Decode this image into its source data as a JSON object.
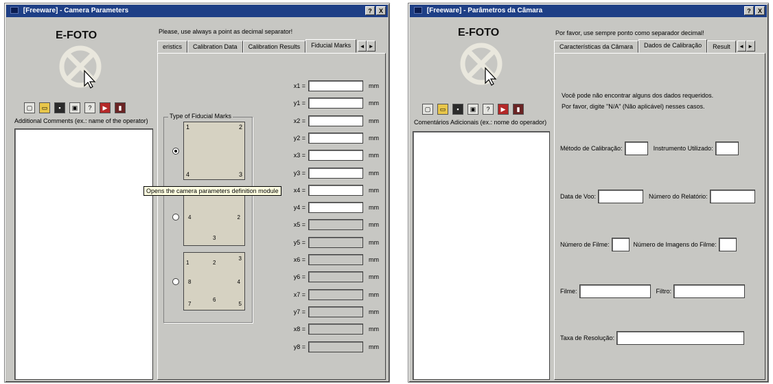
{
  "left": {
    "title": "[Freeware] - Camera Parameters",
    "title_buttons": [
      "?",
      "X"
    ],
    "logo": "E-FOTO",
    "comments_label": "Additional Comments (ex.: name of the operator)",
    "note": "Please, use always a point as decimal separator!",
    "tabs": [
      "eristics",
      "Calibration Data",
      "Calibration Results",
      "Fiducial Marks"
    ],
    "active_tab": "Fiducial Marks",
    "tab_arrows": [
      "◄",
      "►"
    ],
    "groupbox_title": "Type of Fiducial Marks",
    "tooltip": "Opens the camera parameters definition module",
    "fields": [
      {
        "label": "x1 =",
        "unit": "mm",
        "enabled": true
      },
      {
        "label": "y1 =",
        "unit": "mm",
        "enabled": true
      },
      {
        "label": "x2 =",
        "unit": "mm",
        "enabled": true
      },
      {
        "label": "y2 =",
        "unit": "mm",
        "enabled": true
      },
      {
        "label": "x3 =",
        "unit": "mm",
        "enabled": true
      },
      {
        "label": "y3 =",
        "unit": "mm",
        "enabled": true
      },
      {
        "label": "x4 =",
        "unit": "mm",
        "enabled": true
      },
      {
        "label": "y4 =",
        "unit": "mm",
        "enabled": true
      },
      {
        "label": "x5 =",
        "unit": "mm",
        "enabled": false
      },
      {
        "label": "y5 =",
        "unit": "mm",
        "enabled": false
      },
      {
        "label": "x6 =",
        "unit": "mm",
        "enabled": false
      },
      {
        "label": "y6 =",
        "unit": "mm",
        "enabled": false
      },
      {
        "label": "x7 =",
        "unit": "mm",
        "enabled": false
      },
      {
        "label": "y7 =",
        "unit": "mm",
        "enabled": false
      },
      {
        "label": "x8 =",
        "unit": "mm",
        "enabled": false
      },
      {
        "label": "y8 =",
        "unit": "mm",
        "enabled": false
      }
    ],
    "fm_options": [
      {
        "marks": [
          "1",
          "2",
          "4",
          "3"
        ],
        "selected": true
      },
      {
        "marks": [
          "1",
          "2",
          "3",
          "4"
        ],
        "selected": false
      },
      {
        "marks": [
          "1",
          "2",
          "3",
          "8",
          "4",
          "7",
          "6",
          "5"
        ],
        "selected": false
      }
    ]
  },
  "right": {
    "title": "[Freeware] - Parâmetros da Câmara",
    "title_buttons": [
      "?",
      "X"
    ],
    "logo": "E-FOTO",
    "comments_label": "Comentários Adicionais (ex.: nome do operador)",
    "note": "Por favor, use sempre ponto como separador decimal!",
    "tabs": [
      "Características da Câmara",
      "Dados de Calibração",
      "Result"
    ],
    "active_tab": "Dados de Calibração",
    "tab_arrows": [
      "◄",
      "►"
    ],
    "info_line1": "Você pode não encontrar alguns dos dados requeridos.",
    "info_line2": "Por favor, digite \"N/A\" (Não aplicável) nesses casos.",
    "form": {
      "row1": {
        "a": "Método de Calibração:",
        "b": "Instrumento Utilizado:"
      },
      "row2": {
        "a": "Data de Voo:",
        "b": "Número do Relatório:"
      },
      "row3": {
        "a": "Número de Filme:",
        "b": "Número de Imagens do Filme:"
      },
      "row4": {
        "a": "Filme:",
        "b": "Filtro:"
      },
      "row5": {
        "a": "Taxa de Resolução:"
      }
    }
  }
}
